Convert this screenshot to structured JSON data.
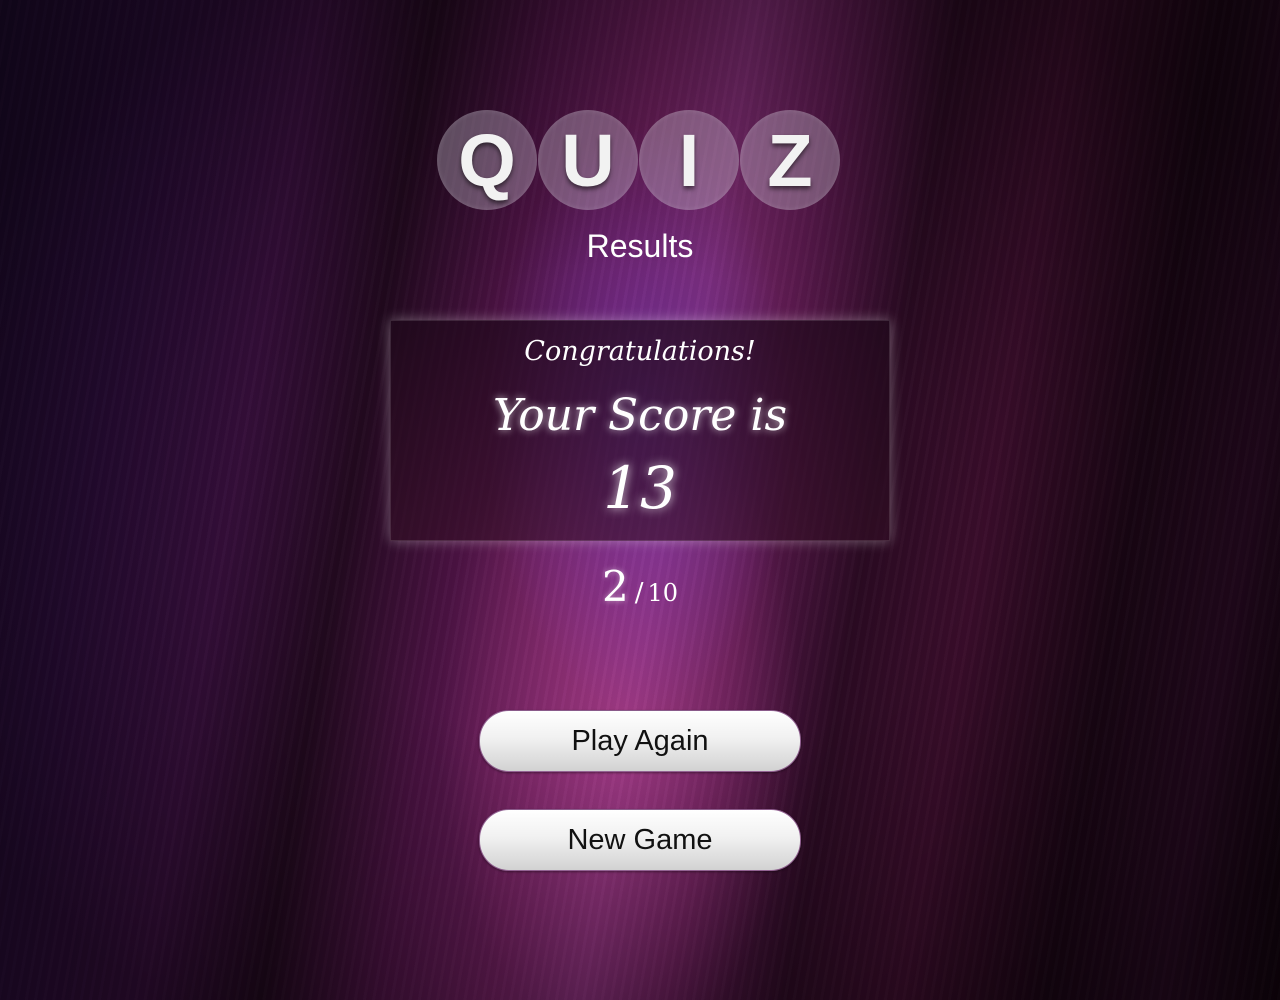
{
  "logo": {
    "letters": [
      "Q",
      "U",
      "I",
      "Z"
    ]
  },
  "header": {
    "subtitle": "Results"
  },
  "result": {
    "congrats": "Congratulations!",
    "score_label": "Your Score is",
    "score_value": "13"
  },
  "progress": {
    "current": "2",
    "separator": "/",
    "total": "10"
  },
  "buttons": {
    "play_again": "Play Again",
    "new_game": "New Game"
  },
  "colors": {
    "background_primary": "#3a0f3f",
    "background_accent": "#7a2a6e",
    "text": "#ffffff",
    "button_text": "#111111"
  }
}
